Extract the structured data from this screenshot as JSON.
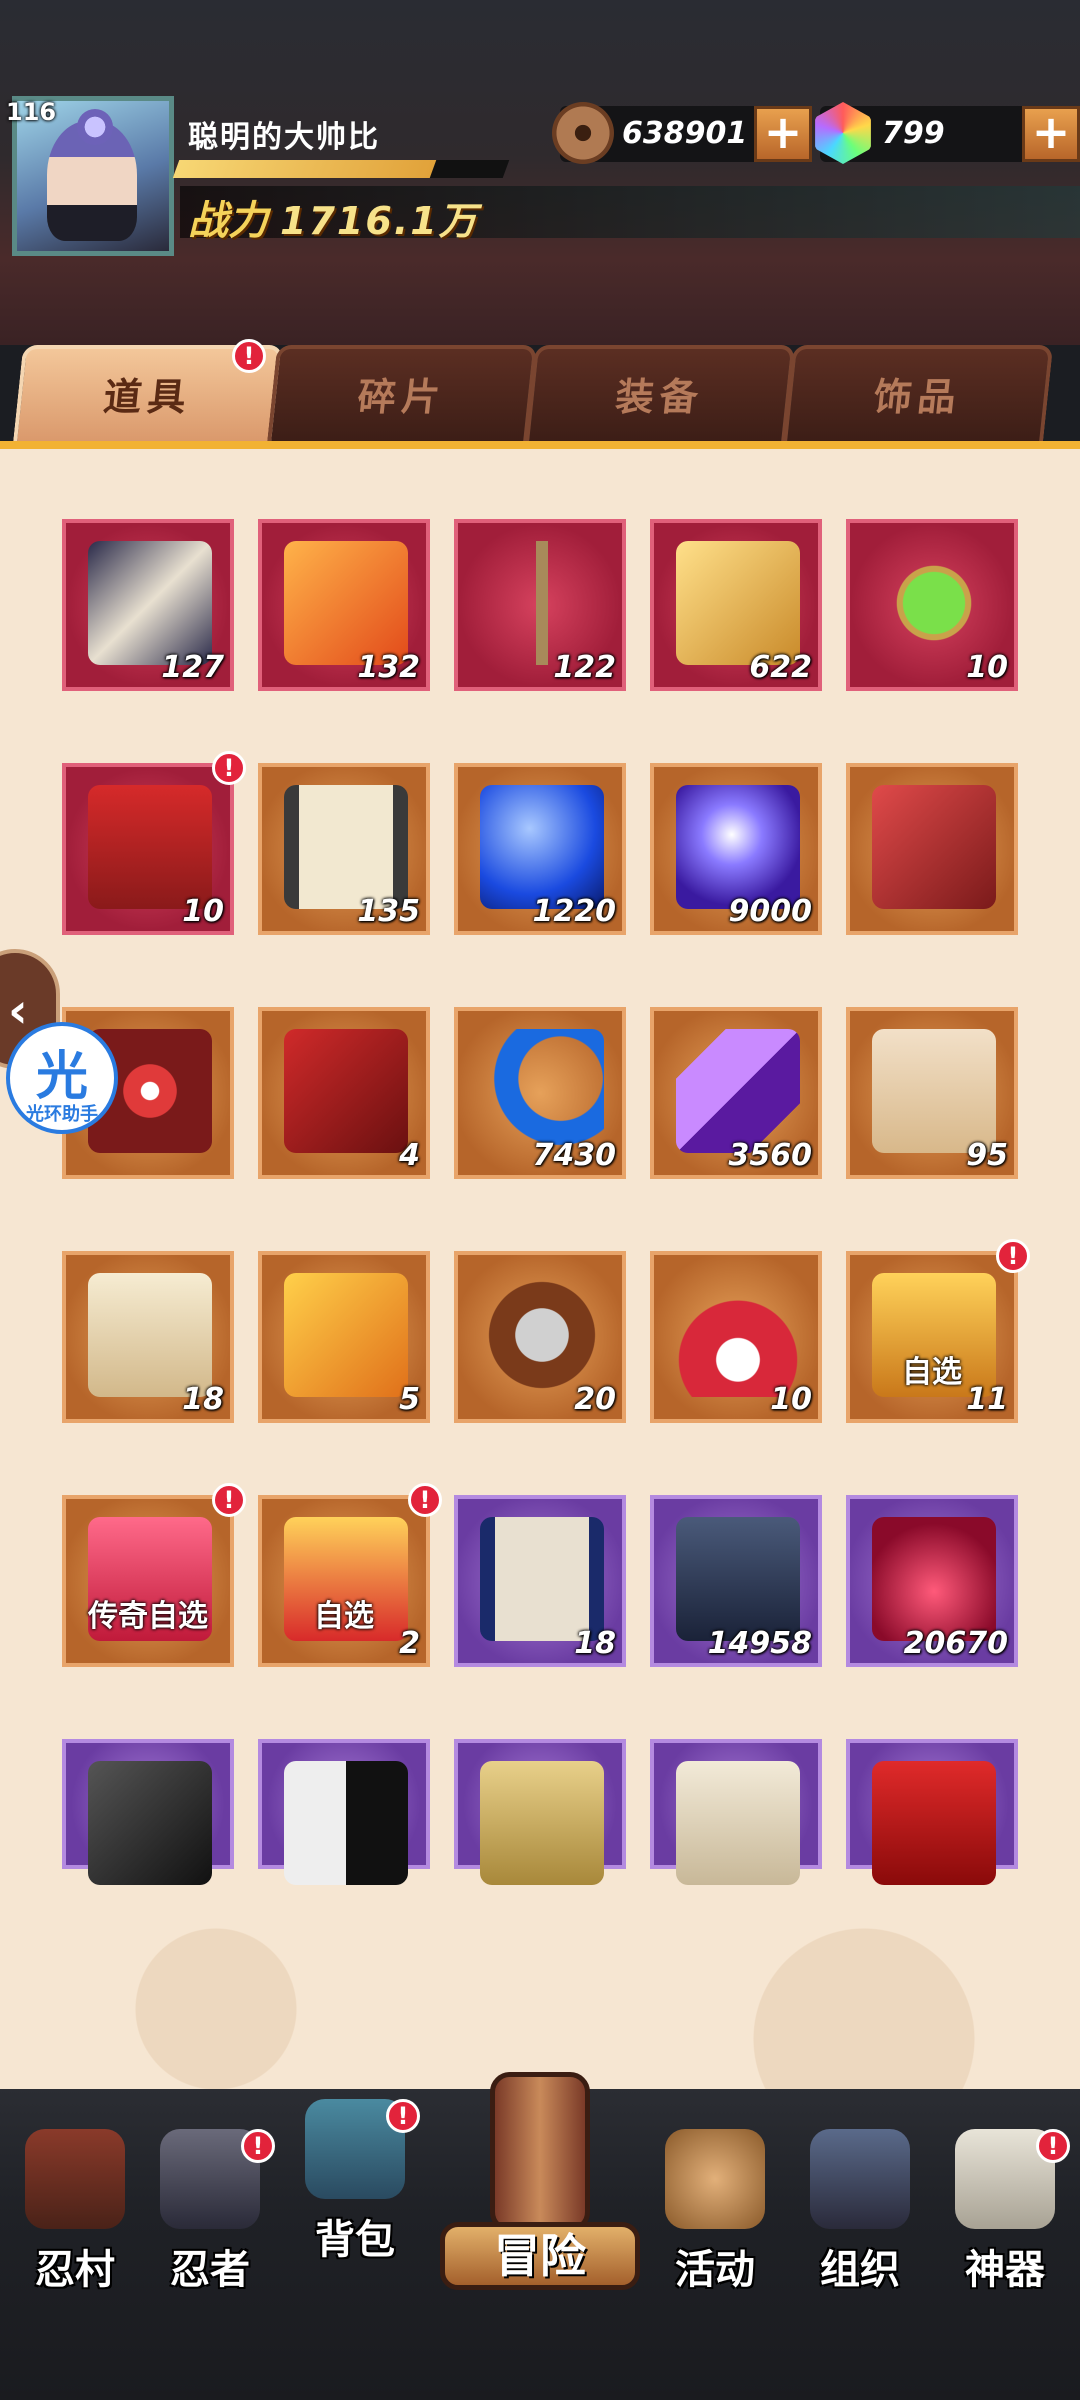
{
  "player": {
    "level": "116",
    "name": "聪明的大帅比",
    "power_label": "战力",
    "power_value": "1716.1万"
  },
  "currencies": {
    "coins": "638901",
    "gems": "799",
    "coin_icon": "copper-coin-icon",
    "gem_icon": "rainbow-gem-icon"
  },
  "tabs": [
    {
      "label": "道具",
      "active": true,
      "alert": "!"
    },
    {
      "label": "碎片",
      "active": false
    },
    {
      "label": "装备",
      "active": false
    },
    {
      "label": "饰品",
      "active": false
    }
  ],
  "items": [
    {
      "icon": "scroll-icon",
      "count": "127",
      "rarity": "red"
    },
    {
      "icon": "red-feather-icon",
      "count": "132",
      "rarity": "red"
    },
    {
      "icon": "stick-icon",
      "count": "122",
      "rarity": "red"
    },
    {
      "icon": "gold-feather-icon",
      "count": "622",
      "rarity": "red"
    },
    {
      "icon": "jade-pendant-icon",
      "count": "10",
      "rarity": "red"
    },
    {
      "icon": "gift-box-icon",
      "count": "10",
      "rarity": "red",
      "alert": "!"
    },
    {
      "icon": "parchment-scroll-icon",
      "count": "135",
      "rarity": "orange"
    },
    {
      "icon": "blue-orb-icon",
      "count": "1220",
      "rarity": "orange"
    },
    {
      "icon": "purple-orb-icon",
      "count": "9000",
      "rarity": "orange"
    },
    {
      "icon": "red-stone-icon",
      "count": "",
      "rarity": "orange"
    },
    {
      "icon": "target-stone-icon",
      "count": "",
      "rarity": "orange"
    },
    {
      "icon": "eye-stone-icon",
      "count": "4",
      "rarity": "orange"
    },
    {
      "icon": "crescent-moon-icon",
      "count": "7430",
      "rarity": "orange"
    },
    {
      "icon": "purple-crystal-icon",
      "count": "3560",
      "rarity": "orange"
    },
    {
      "icon": "fortune-banner-icon",
      "count": "95",
      "rarity": "orange"
    },
    {
      "icon": "talisman-paper-icon",
      "count": "18",
      "rarity": "orange"
    },
    {
      "icon": "amber-stone-icon",
      "count": "5",
      "rarity": "orange"
    },
    {
      "icon": "shuriken-weapon-icon",
      "count": "20",
      "rarity": "orange"
    },
    {
      "icon": "war-fan-icon",
      "count": "10",
      "rarity": "orange"
    },
    {
      "icon": "gold-chest-icon",
      "count": "11",
      "rarity": "orange",
      "label": "自选",
      "alert": "!"
    },
    {
      "icon": "legend-chest-icon",
      "count": "",
      "rarity": "orange",
      "label": "传奇自选",
      "alert": "!"
    },
    {
      "icon": "select-chest-icon",
      "count": "2",
      "rarity": "orange",
      "label": "自选",
      "alert": "!"
    },
    {
      "icon": "blue-scroll-icon",
      "count": "18",
      "rarity": "purple"
    },
    {
      "icon": "book-icon",
      "count": "14958",
      "rarity": "purple"
    },
    {
      "icon": "potion-jar-icon",
      "count": "20670",
      "rarity": "purple"
    },
    {
      "icon": "black-ore-icon",
      "count": "",
      "rarity": "purple"
    },
    {
      "icon": "yin-yang-icon",
      "count": "",
      "rarity": "purple"
    },
    {
      "icon": "gold-vase-icon",
      "count": "",
      "rarity": "purple"
    },
    {
      "icon": "letters-icon",
      "count": "",
      "rarity": "purple"
    },
    {
      "icon": "medkit-icon",
      "count": "",
      "rarity": "purple"
    }
  ],
  "helper": {
    "char": "光",
    "text": "光环助手"
  },
  "nav": [
    {
      "label": "忍村",
      "icon": "village-gate-icon"
    },
    {
      "label": "忍者",
      "icon": "ninja-head-icon",
      "alert": "!"
    },
    {
      "label": "背包",
      "icon": "backpack-icon",
      "alert": "!"
    },
    {
      "label": "冒险",
      "icon": "adventure-scroll-icon"
    },
    {
      "label": "活动",
      "icon": "drum-icon"
    },
    {
      "label": "组织",
      "icon": "group-icon"
    },
    {
      "label": "神器",
      "icon": "artifact-scroll-icon",
      "alert": "!"
    }
  ],
  "colors": {
    "accent": "#f2b233",
    "alert": "#e2233b"
  }
}
